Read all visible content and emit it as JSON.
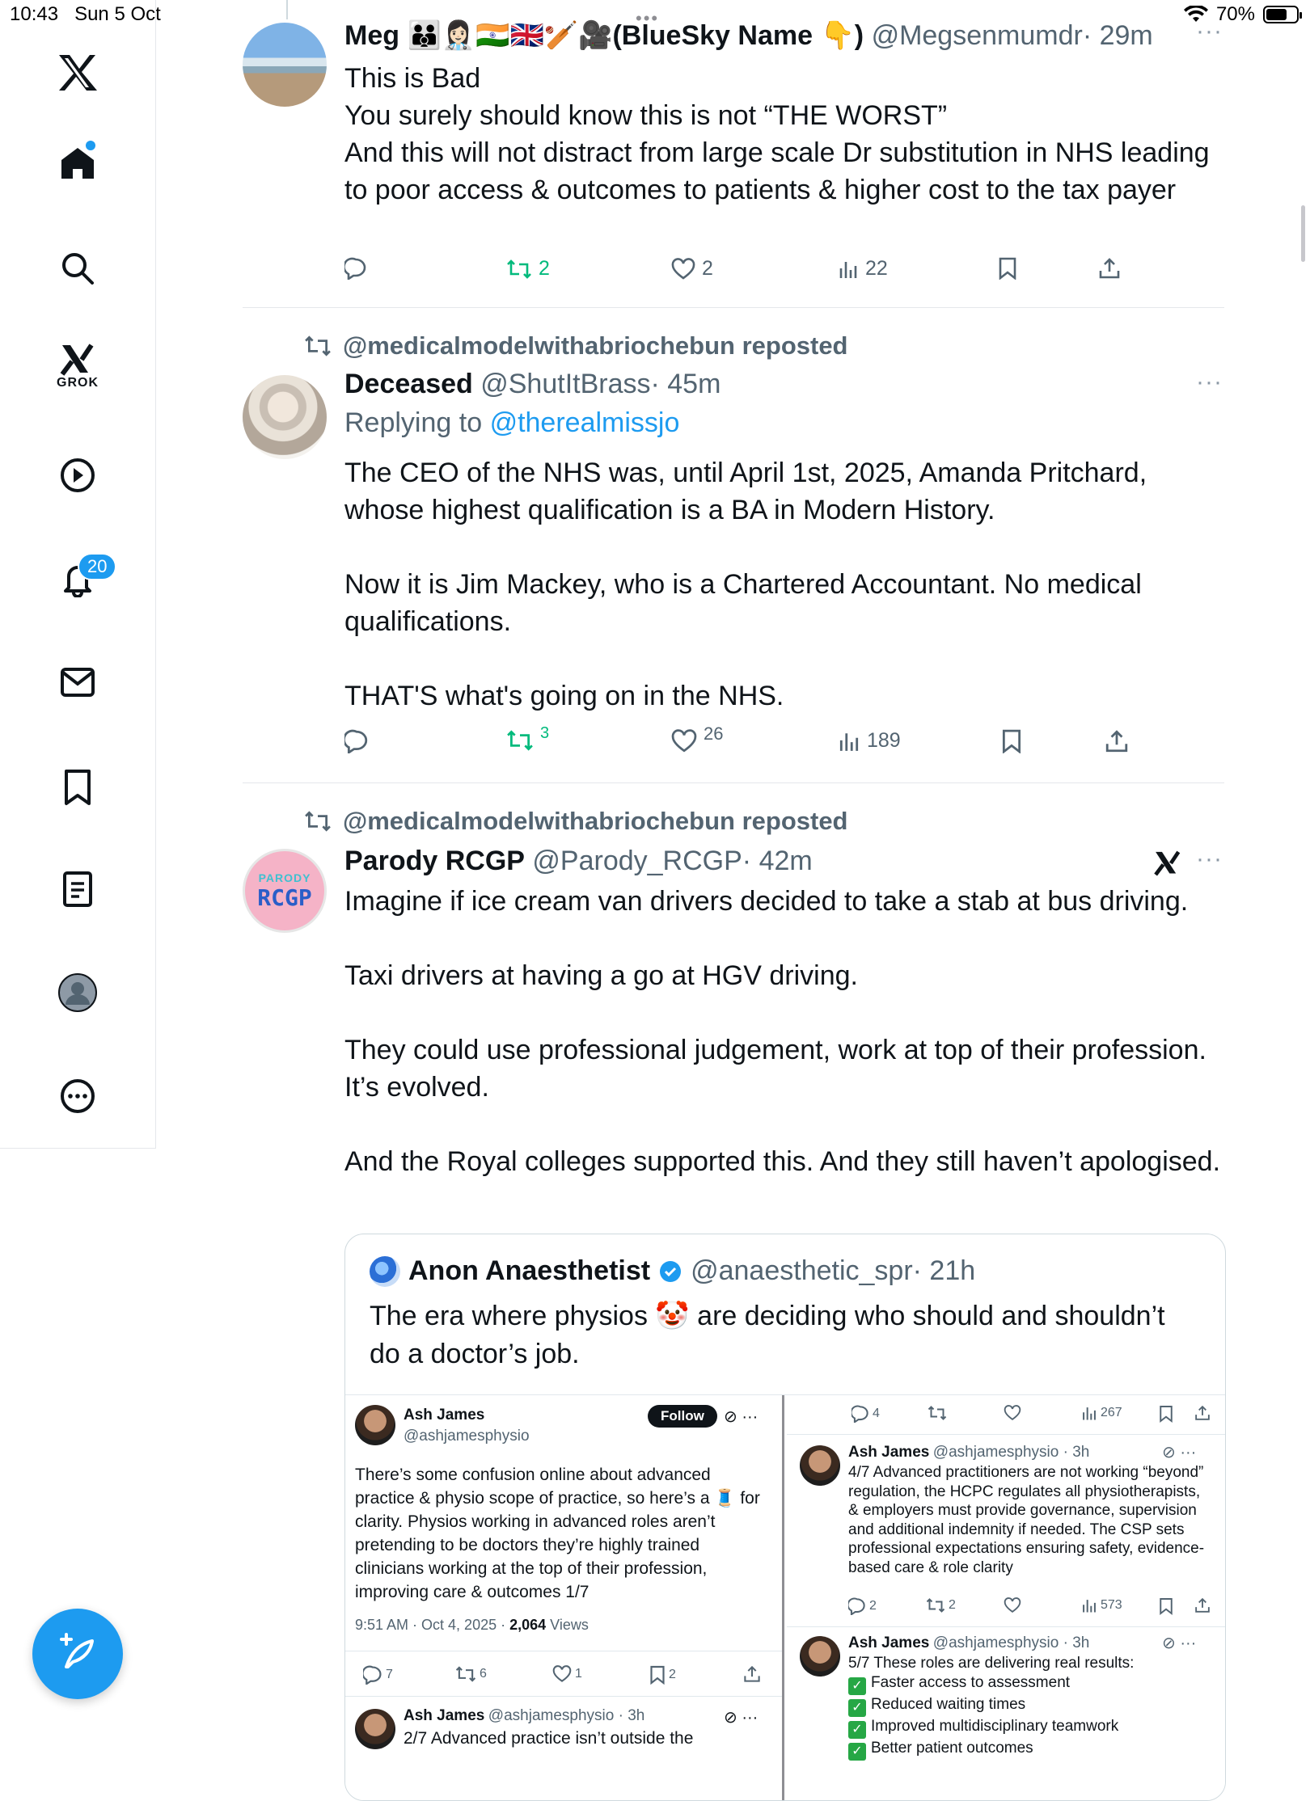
{
  "status_bar": {
    "time": "10:43",
    "date": "Sun 5 Oct",
    "battery": "70%",
    "battery_level": 0.7
  },
  "sidebar": {
    "grok_label": "GROK",
    "notifications_badge": "20"
  },
  "posts": [
    {
      "name": "Meg",
      "name_suffix": "🧑‍🧑‍🧒👩🏻‍⚕️🇮🇳🇬🇧🏏🎥(BlueSky Name 👇)",
      "handle": "@Megsenmumdr",
      "time": "· 29m",
      "lines": [
        "This is Bad",
        "You surely should know this is not “THE WORST”",
        "And this will not distract from large scale Dr substitution in NHS leading to poor access & outcomes to patients & higher cost to the tax payer"
      ],
      "retweets": "2",
      "likes": "2",
      "views": "22"
    },
    {
      "reposted_by": "@medicalmodelwithabriochebun reposted",
      "name": "Deceased",
      "handle": "@ShutItBrass",
      "time": "· 45m",
      "replying_prefix": "Replying to",
      "replying_to": "@therealmissjo",
      "paragraphs": [
        "The CEO of the NHS was, until April 1st, 2025, Amanda Pritchard, whose highest qualification is a BA in Modern History.",
        "Now it is Jim Mackey, who is a Chartered Accountant.  No medical qualifications.",
        "THAT'S what's going on in the NHS."
      ],
      "retweets": "3",
      "likes": "26",
      "views": "189"
    },
    {
      "reposted_by": "@medicalmodelwithabriochebun reposted",
      "name": "Parody RCGP",
      "handle": "@Parody_RCGP",
      "time": "· 42m",
      "avatar_top": "PARODY",
      "avatar_main": "RCGP",
      "paragraphs": [
        "Imagine if ice cream van drivers decided to take a stab at bus driving.",
        "Taxi drivers at having a go at HGV driving.",
        "They could use professional judgement, work at top of their profession. It’s evolved.",
        "And the Royal colleges supported this. And they still haven’t apologised."
      ],
      "quote": {
        "name": "Anon Anaesthetist",
        "handle": "@anaesthetic_spr",
        "time": "· 21h",
        "text": "The era where physios 🤡 are deciding who should and shouldn’t do a doctor’s job.",
        "image": {
          "left": {
            "name": "Ash James",
            "handle": "@ashjamesphysio",
            "follow": "Follow",
            "text": "There’s some confusion online about advanced practice & physio scope of practice, so here’s a 🧵 for clarity. Physios working in advanced roles aren’t pretending to be doctors they’re highly trained clinicians working at the top of their profession, improving care & outcomes 1/7",
            "timestamp": "9:51 AM · Oct 4, 2025 ·",
            "views_count": "2,064",
            "views_label": "Views",
            "replies": "7",
            "retweets": "6",
            "likes": "1",
            "bookmarks": "2",
            "next_name": "Ash James",
            "next_handle": "@ashjamesphysio · 3h",
            "next_text": "2/7 Advanced practice isn’t outside the"
          },
          "right": {
            "top_replies": "4",
            "top_views": "267",
            "t1_name": "Ash James",
            "t1_handle": "@ashjamesphysio · 3h",
            "t1_text": "4/7 Advanced practitioners are not working “beyond” regulation, the HCPC regulates all physiotherapists, & employers must provide governance, supervision and additional indemnity if needed. The CSP sets professional expectations ensuring safety, evidence-based care & role clarity",
            "t1_replies": "2",
            "t1_retweets": "2",
            "t1_views": "573",
            "t2_name": "Ash James",
            "t2_handle": "@ashjamesphysio · 3h",
            "t2_intro": "5/7 These roles are delivering real results:",
            "t2_items": [
              "Faster access to assessment",
              "Reduced waiting times",
              "Improved multidisciplinary teamwork",
              "Better patient outcomes"
            ]
          }
        }
      }
    }
  ],
  "colors": {
    "accent": "#1d9bf0",
    "retweet_green": "#00ba7c",
    "muted": "#536471"
  }
}
